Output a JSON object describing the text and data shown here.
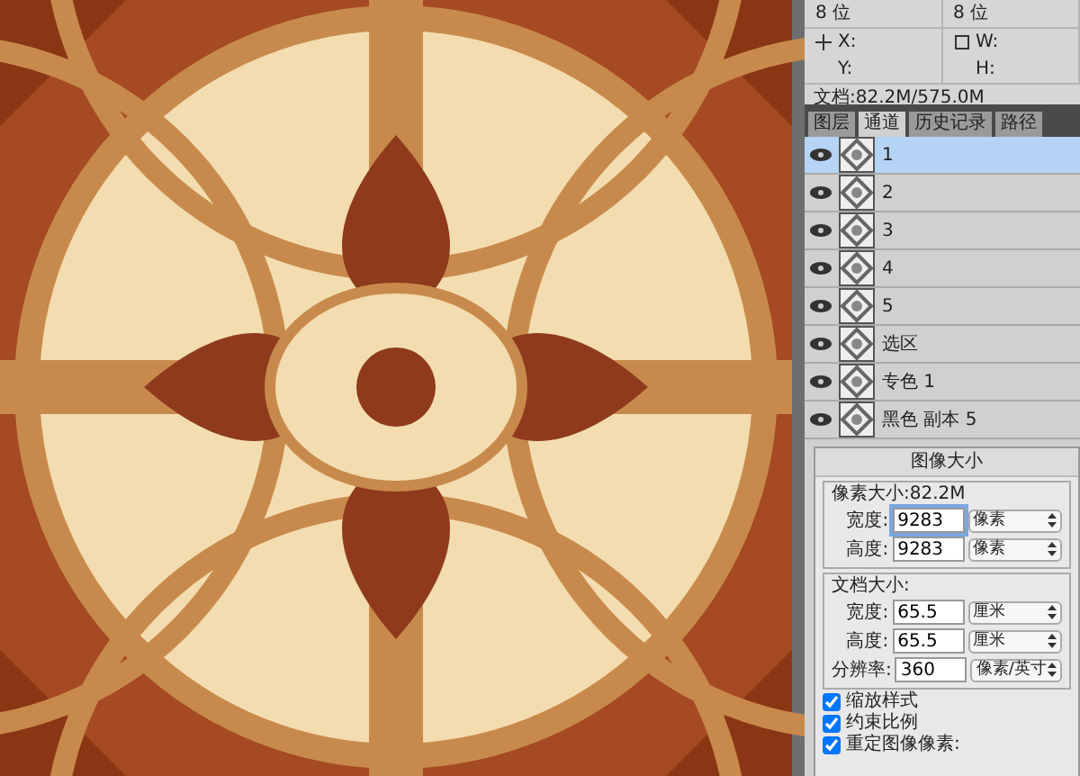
{
  "info_panel": {
    "depth": [
      "8 位",
      "8 位"
    ],
    "fields": [
      {
        "label": "X:",
        "kind": "crosshair"
      },
      {
        "label": "Y:",
        "kind": "none"
      },
      {
        "label": "W:",
        "kind": "frame"
      },
      {
        "label": "H:",
        "kind": "none"
      }
    ],
    "doc_size": "文档:82.2M/575.0M"
  },
  "tabs": [
    {
      "label": "图层",
      "selected": false
    },
    {
      "label": "通道",
      "selected": true
    },
    {
      "label": "历史记录",
      "selected": false
    },
    {
      "label": "路径",
      "selected": false
    }
  ],
  "channels": [
    {
      "name": "1",
      "selected": true
    },
    {
      "name": "2",
      "selected": false
    },
    {
      "name": "3",
      "selected": false
    },
    {
      "name": "4",
      "selected": false
    },
    {
      "name": "5",
      "selected": false
    },
    {
      "name": "选区",
      "selected": false
    },
    {
      "name": "专色 1",
      "selected": false
    },
    {
      "name": "黑色 副本 5",
      "selected": false
    }
  ],
  "dialog": {
    "title": "图像大小",
    "groups": [
      {
        "legend": "像素大小:82.2M",
        "rows": [
          {
            "label": "宽度:",
            "value": "9283",
            "unit": "像素",
            "focused": true
          },
          {
            "label": "高度:",
            "value": "9283",
            "unit": "像素",
            "focused": false
          }
        ]
      },
      {
        "legend": "文档大小:",
        "rows": [
          {
            "label": "宽度:",
            "value": "65.5",
            "unit": "厘米",
            "focused": false
          },
          {
            "label": "高度:",
            "value": "65.5",
            "unit": "厘米",
            "focused": false
          },
          {
            "label": "分辨率:",
            "value": "360",
            "unit": "像素/英寸",
            "focused": false
          }
        ]
      }
    ],
    "options": [
      {
        "label": "缩放样式",
        "checked": true
      },
      {
        "label": "约束比例",
        "checked": true
      },
      {
        "label": "重定图像像素:",
        "checked": true
      }
    ]
  }
}
